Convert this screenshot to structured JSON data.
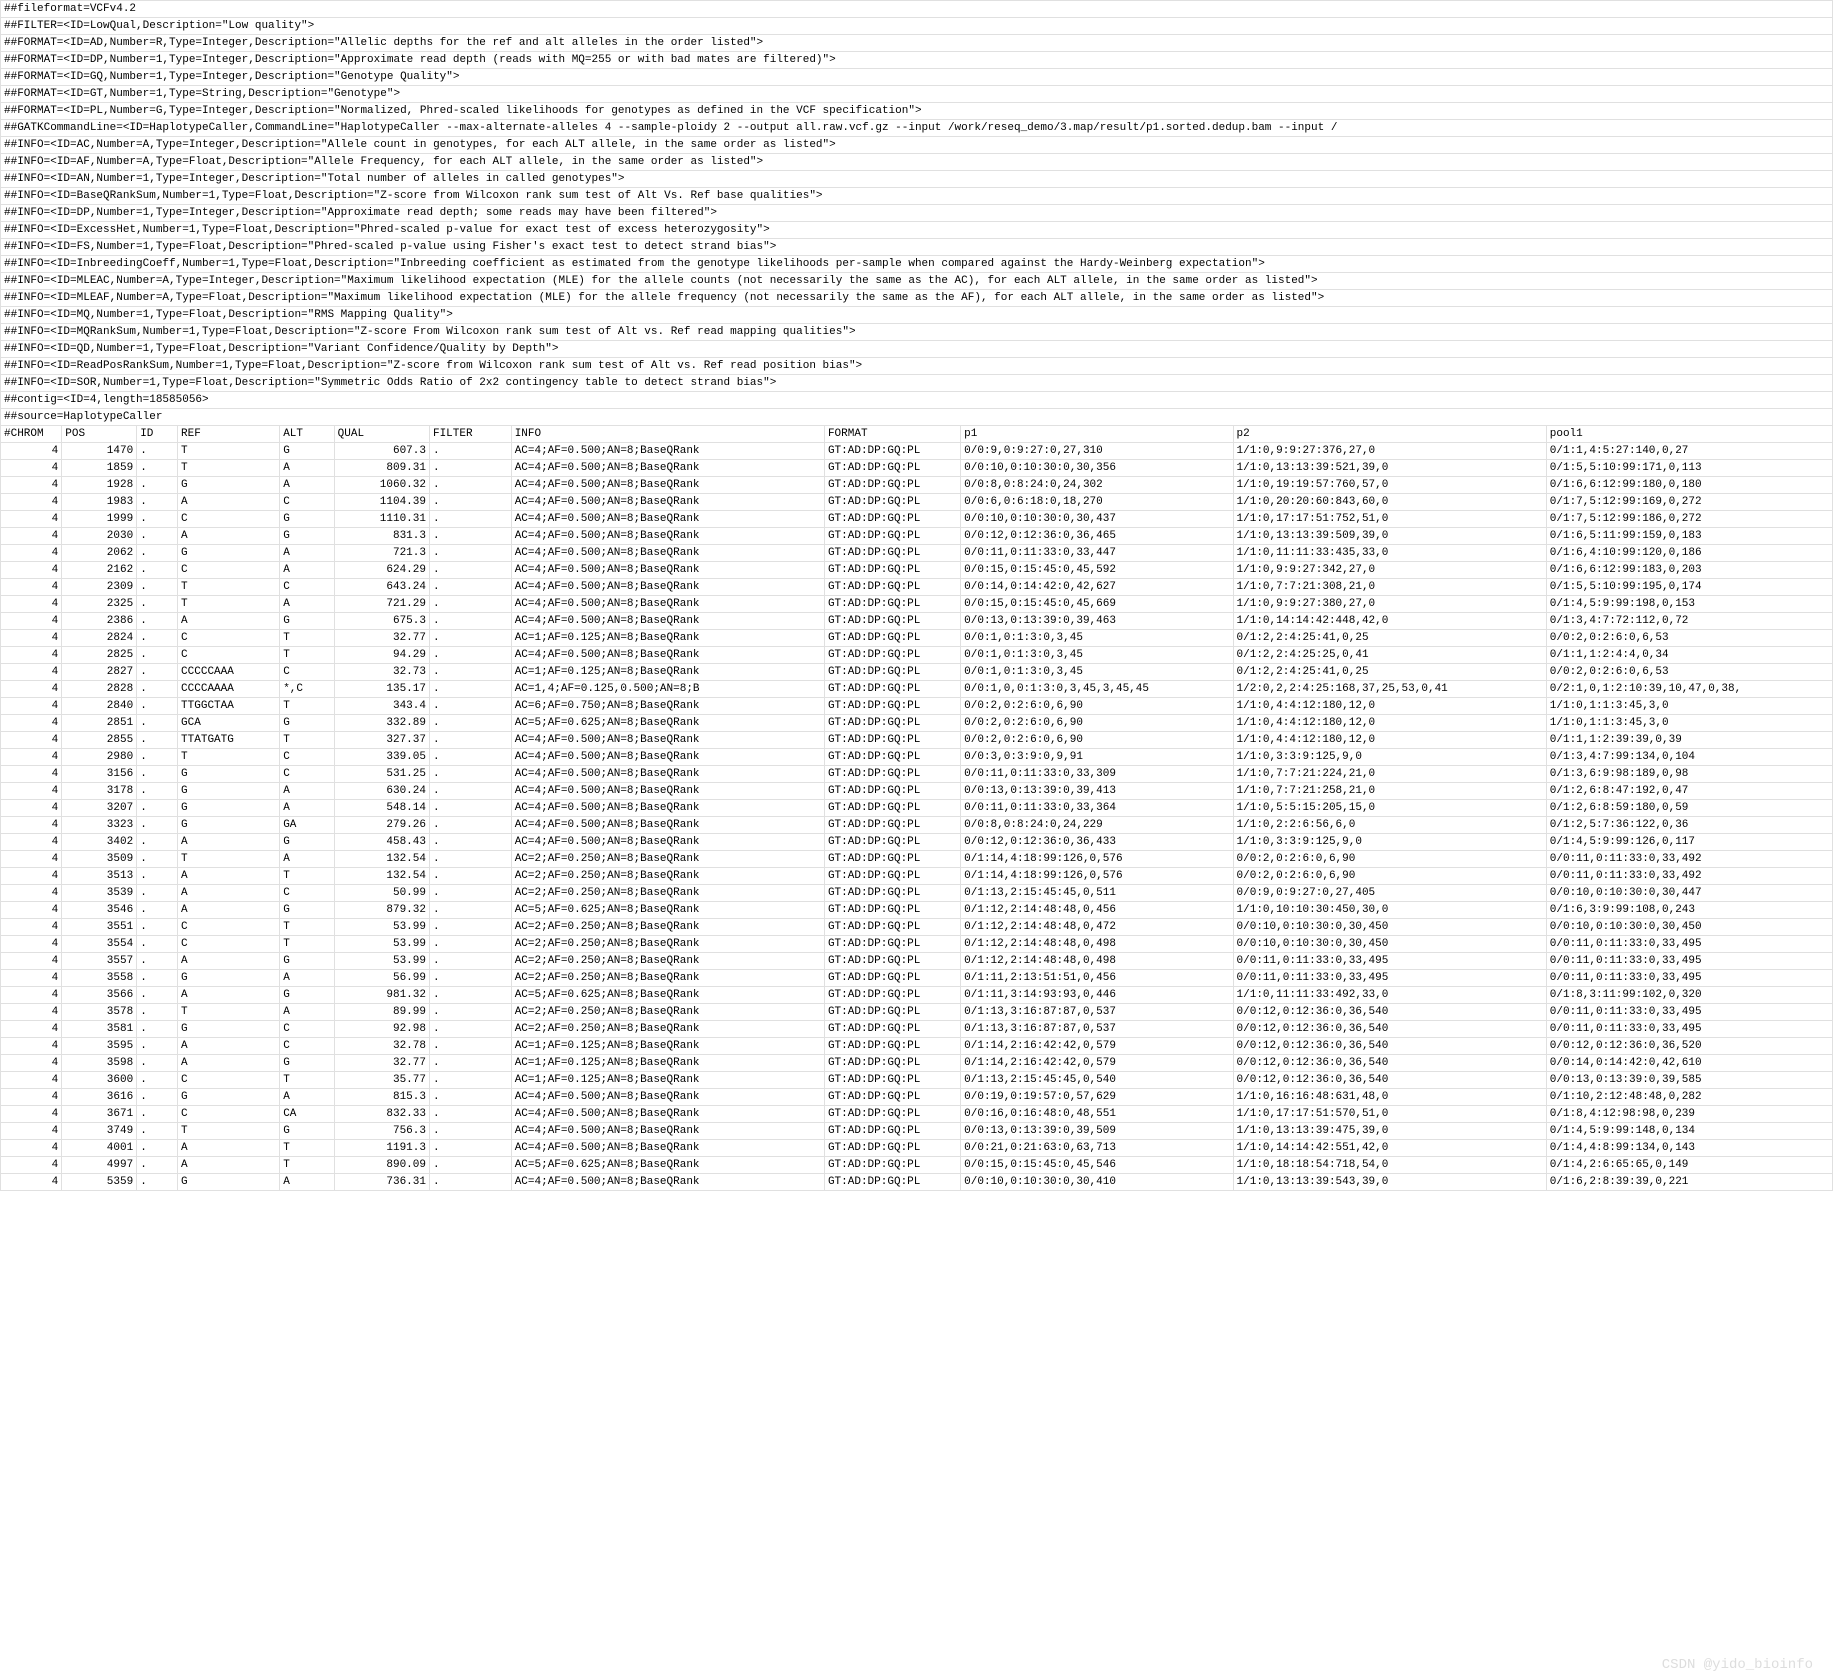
{
  "headers": [
    "##fileformat=VCFv4.2",
    "##FILTER=<ID=LowQual,Description=\"Low quality\">",
    "##FORMAT=<ID=AD,Number=R,Type=Integer,Description=\"Allelic depths for the ref and alt alleles in the order listed\">",
    "##FORMAT=<ID=DP,Number=1,Type=Integer,Description=\"Approximate read depth (reads with MQ=255 or with bad mates are filtered)\">",
    "##FORMAT=<ID=GQ,Number=1,Type=Integer,Description=\"Genotype Quality\">",
    "##FORMAT=<ID=GT,Number=1,Type=String,Description=\"Genotype\">",
    "##FORMAT=<ID=PL,Number=G,Type=Integer,Description=\"Normalized, Phred-scaled likelihoods for genotypes as defined in the VCF specification\">",
    "##GATKCommandLine=<ID=HaplotypeCaller,CommandLine=\"HaplotypeCaller  --max-alternate-alleles 4 --sample-ploidy 2 --output all.raw.vcf.gz --input /work/reseq_demo/3.map/result/p1.sorted.dedup.bam --input /",
    "##INFO=<ID=AC,Number=A,Type=Integer,Description=\"Allele count in genotypes, for each ALT allele, in the same order as listed\">",
    "##INFO=<ID=AF,Number=A,Type=Float,Description=\"Allele Frequency, for each ALT allele, in the same order as listed\">",
    "##INFO=<ID=AN,Number=1,Type=Integer,Description=\"Total number of alleles in called genotypes\">",
    "##INFO=<ID=BaseQRankSum,Number=1,Type=Float,Description=\"Z-score from Wilcoxon rank sum test of Alt Vs. Ref base qualities\">",
    "##INFO=<ID=DP,Number=1,Type=Integer,Description=\"Approximate read depth; some reads may have been filtered\">",
    "##INFO=<ID=ExcessHet,Number=1,Type=Float,Description=\"Phred-scaled p-value for exact test of excess heterozygosity\">",
    "##INFO=<ID=FS,Number=1,Type=Float,Description=\"Phred-scaled p-value using Fisher's exact test to detect strand bias\">",
    "##INFO=<ID=InbreedingCoeff,Number=1,Type=Float,Description=\"Inbreeding coefficient as estimated from the genotype likelihoods per-sample when compared against the Hardy-Weinberg expectation\">",
    "##INFO=<ID=MLEAC,Number=A,Type=Integer,Description=\"Maximum likelihood expectation (MLE) for the allele counts (not necessarily the same as the AC), for each ALT allele, in the same order as listed\">",
    "##INFO=<ID=MLEAF,Number=A,Type=Float,Description=\"Maximum likelihood expectation (MLE) for the allele frequency (not necessarily the same as the AF), for each ALT allele, in the same order as listed\">",
    "##INFO=<ID=MQ,Number=1,Type=Float,Description=\"RMS Mapping Quality\">",
    "##INFO=<ID=MQRankSum,Number=1,Type=Float,Description=\"Z-score From Wilcoxon rank sum test of Alt vs. Ref read mapping qualities\">",
    "##INFO=<ID=QD,Number=1,Type=Float,Description=\"Variant Confidence/Quality by Depth\">",
    "##INFO=<ID=ReadPosRankSum,Number=1,Type=Float,Description=\"Z-score from Wilcoxon rank sum test of Alt vs. Ref read position bias\">",
    "##INFO=<ID=SOR,Number=1,Type=Float,Description=\"Symmetric Odds Ratio of 2x2 contingency table to detect strand bias\">",
    "##contig=<ID=4,length=18585056>",
    "##source=HaplotypeCaller"
  ],
  "columns": [
    "#CHROM",
    "POS",
    "ID",
    "REF",
    "ALT",
    "QUAL",
    "FILTER",
    "INFO",
    "FORMAT",
    "p1",
    "p2",
    "pool1"
  ],
  "rows": [
    [
      "4",
      "1470",
      ".",
      "T",
      "G",
      "607.3",
      ".",
      "AC=4;AF=0.500;AN=8;BaseQRank",
      "GT:AD:DP:GQ:PL",
      "0/0:9,0:9:27:0,27,310",
      "1/1:0,9:9:27:376,27,0",
      "0/1:1,4:5:27:140,0,27"
    ],
    [
      "4",
      "1859",
      ".",
      "T",
      "A",
      "809.31",
      ".",
      "AC=4;AF=0.500;AN=8;BaseQRank",
      "GT:AD:DP:GQ:PL",
      "0/0:10,0:10:30:0,30,356",
      "1/1:0,13:13:39:521,39,0",
      "0/1:5,5:10:99:171,0,113"
    ],
    [
      "4",
      "1928",
      ".",
      "G",
      "A",
      "1060.32",
      ".",
      "AC=4;AF=0.500;AN=8;BaseQRank",
      "GT:AD:DP:GQ:PL",
      "0/0:8,0:8:24:0,24,302",
      "1/1:0,19:19:57:760,57,0",
      "0/1:6,6:12:99:180,0,180"
    ],
    [
      "4",
      "1983",
      ".",
      "A",
      "C",
      "1104.39",
      ".",
      "AC=4;AF=0.500;AN=8;BaseQRank",
      "GT:AD:DP:GQ:PL",
      "0/0:6,0:6:18:0,18,270",
      "1/1:0,20:20:60:843,60,0",
      "0/1:7,5:12:99:169,0,272"
    ],
    [
      "4",
      "1999",
      ".",
      "C",
      "G",
      "1110.31",
      ".",
      "AC=4;AF=0.500;AN=8;BaseQRank",
      "GT:AD:DP:GQ:PL",
      "0/0:10,0:10:30:0,30,437",
      "1/1:0,17:17:51:752,51,0",
      "0/1:7,5:12:99:186,0,272"
    ],
    [
      "4",
      "2030",
      ".",
      "A",
      "G",
      "831.3",
      ".",
      "AC=4;AF=0.500;AN=8;BaseQRank",
      "GT:AD:DP:GQ:PL",
      "0/0:12,0:12:36:0,36,465",
      "1/1:0,13:13:39:509,39,0",
      "0/1:6,5:11:99:159,0,183"
    ],
    [
      "4",
      "2062",
      ".",
      "G",
      "A",
      "721.3",
      ".",
      "AC=4;AF=0.500;AN=8;BaseQRank",
      "GT:AD:DP:GQ:PL",
      "0/0:11,0:11:33:0,33,447",
      "1/1:0,11:11:33:435,33,0",
      "0/1:6,4:10:99:120,0,186"
    ],
    [
      "4",
      "2162",
      ".",
      "C",
      "A",
      "624.29",
      ".",
      "AC=4;AF=0.500;AN=8;BaseQRank",
      "GT:AD:DP:GQ:PL",
      "0/0:15,0:15:45:0,45,592",
      "1/1:0,9:9:27:342,27,0",
      "0/1:6,6:12:99:183,0,203"
    ],
    [
      "4",
      "2309",
      ".",
      "T",
      "C",
      "643.24",
      ".",
      "AC=4;AF=0.500;AN=8;BaseQRank",
      "GT:AD:DP:GQ:PL",
      "0/0:14,0:14:42:0,42,627",
      "1/1:0,7:7:21:308,21,0",
      "0/1:5,5:10:99:195,0,174"
    ],
    [
      "4",
      "2325",
      ".",
      "T",
      "A",
      "721.29",
      ".",
      "AC=4;AF=0.500;AN=8;BaseQRank",
      "GT:AD:DP:GQ:PL",
      "0/0:15,0:15:45:0,45,669",
      "1/1:0,9:9:27:380,27,0",
      "0/1:4,5:9:99:198,0,153"
    ],
    [
      "4",
      "2386",
      ".",
      "A",
      "G",
      "675.3",
      ".",
      "AC=4;AF=0.500;AN=8;BaseQRank",
      "GT:AD:DP:GQ:PL",
      "0/0:13,0:13:39:0,39,463",
      "1/1:0,14:14:42:448,42,0",
      "0/1:3,4:7:72:112,0,72"
    ],
    [
      "4",
      "2824",
      ".",
      "C",
      "T",
      "32.77",
      ".",
      "AC=1;AF=0.125;AN=8;BaseQRank",
      "GT:AD:DP:GQ:PL",
      "0/0:1,0:1:3:0,3,45",
      "0/1:2,2:4:25:41,0,25",
      "0/0:2,0:2:6:0,6,53"
    ],
    [
      "4",
      "2825",
      ".",
      "C",
      "T",
      "94.29",
      ".",
      "AC=4;AF=0.500;AN=8;BaseQRank",
      "GT:AD:DP:GQ:PL",
      "0/0:1,0:1:3:0,3,45",
      "0/1:2,2:4:25:25,0,41",
      "0/1:1,1:2:4:4,0,34"
    ],
    [
      "4",
      "2827",
      ".",
      "CCCCCAAA",
      "C",
      "32.73",
      ".",
      "AC=1;AF=0.125;AN=8;BaseQRank",
      "GT:AD:DP:GQ:PL",
      "0/0:1,0:1:3:0,3,45",
      "0/1:2,2:4:25:41,0,25",
      "0/0:2,0:2:6:0,6,53"
    ],
    [
      "4",
      "2828",
      ".",
      "CCCCAAAA",
      "*,C",
      "135.17",
      ".",
      "AC=1,4;AF=0.125,0.500;AN=8;B",
      "GT:AD:DP:GQ:PL",
      "0/0:1,0,0:1:3:0,3,45,3,45,45",
      "1/2:0,2,2:4:25:168,37,25,53,0,41",
      "0/2:1,0,1:2:10:39,10,47,0,38,"
    ],
    [
      "4",
      "2840",
      ".",
      "TTGGCTAA",
      "T",
      "343.4",
      ".",
      "AC=6;AF=0.750;AN=8;BaseQRank",
      "GT:AD:DP:GQ:PL",
      "0/0:2,0:2:6:0,6,90",
      "1/1:0,4:4:12:180,12,0",
      "1/1:0,1:1:3:45,3,0"
    ],
    [
      "4",
      "2851",
      ".",
      "GCA",
      "G",
      "332.89",
      ".",
      "AC=5;AF=0.625;AN=8;BaseQRank",
      "GT:AD:DP:GQ:PL",
      "0/0:2,0:2:6:0,6,90",
      "1/1:0,4:4:12:180,12,0",
      "1/1:0,1:1:3:45,3,0"
    ],
    [
      "4",
      "2855",
      ".",
      "TTATGATG",
      "T",
      "327.37",
      ".",
      "AC=4;AF=0.500;AN=8;BaseQRank",
      "GT:AD:DP:GQ:PL",
      "0/0:2,0:2:6:0,6,90",
      "1/1:0,4:4:12:180,12,0",
      "0/1:1,1:2:39:39,0,39"
    ],
    [
      "4",
      "2980",
      ".",
      "T",
      "C",
      "339.05",
      ".",
      "AC=4;AF=0.500;AN=8;BaseQRank",
      "GT:AD:DP:GQ:PL",
      "0/0:3,0:3:9:0,9,91",
      "1/1:0,3:3:9:125,9,0",
      "0/1:3,4:7:99:134,0,104"
    ],
    [
      "4",
      "3156",
      ".",
      "G",
      "C",
      "531.25",
      ".",
      "AC=4;AF=0.500;AN=8;BaseQRank",
      "GT:AD:DP:GQ:PL",
      "0/0:11,0:11:33:0,33,309",
      "1/1:0,7:7:21:224,21,0",
      "0/1:3,6:9:98:189,0,98"
    ],
    [
      "4",
      "3178",
      ".",
      "G",
      "A",
      "630.24",
      ".",
      "AC=4;AF=0.500;AN=8;BaseQRank",
      "GT:AD:DP:GQ:PL",
      "0/0:13,0:13:39:0,39,413",
      "1/1:0,7:7:21:258,21,0",
      "0/1:2,6:8:47:192,0,47"
    ],
    [
      "4",
      "3207",
      ".",
      "G",
      "A",
      "548.14",
      ".",
      "AC=4;AF=0.500;AN=8;BaseQRank",
      "GT:AD:DP:GQ:PL",
      "0/0:11,0:11:33:0,33,364",
      "1/1:0,5:5:15:205,15,0",
      "0/1:2,6:8:59:180,0,59"
    ],
    [
      "4",
      "3323",
      ".",
      "G",
      "GA",
      "279.26",
      ".",
      "AC=4;AF=0.500;AN=8;BaseQRank",
      "GT:AD:DP:GQ:PL",
      "0/0:8,0:8:24:0,24,229",
      "1/1:0,2:2:6:56,6,0",
      "0/1:2,5:7:36:122,0,36"
    ],
    [
      "4",
      "3402",
      ".",
      "A",
      "G",
      "458.43",
      ".",
      "AC=4;AF=0.500;AN=8;BaseQRank",
      "GT:AD:DP:GQ:PL",
      "0/0:12,0:12:36:0,36,433",
      "1/1:0,3:3:9:125,9,0",
      "0/1:4,5:9:99:126,0,117"
    ],
    [
      "4",
      "3509",
      ".",
      "T",
      "A",
      "132.54",
      ".",
      "AC=2;AF=0.250;AN=8;BaseQRank",
      "GT:AD:DP:GQ:PL",
      "0/1:14,4:18:99:126,0,576",
      "0/0:2,0:2:6:0,6,90",
      "0/0:11,0:11:33:0,33,492"
    ],
    [
      "4",
      "3513",
      ".",
      "A",
      "T",
      "132.54",
      ".",
      "AC=2;AF=0.250;AN=8;BaseQRank",
      "GT:AD:DP:GQ:PL",
      "0/1:14,4:18:99:126,0,576",
      "0/0:2,0:2:6:0,6,90",
      "0/0:11,0:11:33:0,33,492"
    ],
    [
      "4",
      "3539",
      ".",
      "A",
      "C",
      "50.99",
      ".",
      "AC=2;AF=0.250;AN=8;BaseQRank",
      "GT:AD:DP:GQ:PL",
      "0/1:13,2:15:45:45,0,511",
      "0/0:9,0:9:27:0,27,405",
      "0/0:10,0:10:30:0,30,447"
    ],
    [
      "4",
      "3546",
      ".",
      "A",
      "G",
      "879.32",
      ".",
      "AC=5;AF=0.625;AN=8;BaseQRank",
      "GT:AD:DP:GQ:PL",
      "0/1:12,2:14:48:48,0,456",
      "1/1:0,10:10:30:450,30,0",
      "0/1:6,3:9:99:108,0,243"
    ],
    [
      "4",
      "3551",
      ".",
      "C",
      "T",
      "53.99",
      ".",
      "AC=2;AF=0.250;AN=8;BaseQRank",
      "GT:AD:DP:GQ:PL",
      "0/1:12,2:14:48:48,0,472",
      "0/0:10,0:10:30:0,30,450",
      "0/0:10,0:10:30:0,30,450"
    ],
    [
      "4",
      "3554",
      ".",
      "C",
      "T",
      "53.99",
      ".",
      "AC=2;AF=0.250;AN=8;BaseQRank",
      "GT:AD:DP:GQ:PL",
      "0/1:12,2:14:48:48,0,498",
      "0/0:10,0:10:30:0,30,450",
      "0/0:11,0:11:33:0,33,495"
    ],
    [
      "4",
      "3557",
      ".",
      "A",
      "G",
      "53.99",
      ".",
      "AC=2;AF=0.250;AN=8;BaseQRank",
      "GT:AD:DP:GQ:PL",
      "0/1:12,2:14:48:48,0,498",
      "0/0:11,0:11:33:0,33,495",
      "0/0:11,0:11:33:0,33,495"
    ],
    [
      "4",
      "3558",
      ".",
      "G",
      "A",
      "56.99",
      ".",
      "AC=2;AF=0.250;AN=8;BaseQRank",
      "GT:AD:DP:GQ:PL",
      "0/1:11,2:13:51:51,0,456",
      "0/0:11,0:11:33:0,33,495",
      "0/0:11,0:11:33:0,33,495"
    ],
    [
      "4",
      "3566",
      ".",
      "A",
      "G",
      "981.32",
      ".",
      "AC=5;AF=0.625;AN=8;BaseQRank",
      "GT:AD:DP:GQ:PL",
      "0/1:11,3:14:93:93,0,446",
      "1/1:0,11:11:33:492,33,0",
      "0/1:8,3:11:99:102,0,320"
    ],
    [
      "4",
      "3578",
      ".",
      "T",
      "A",
      "89.99",
      ".",
      "AC=2;AF=0.250;AN=8;BaseQRank",
      "GT:AD:DP:GQ:PL",
      "0/1:13,3:16:87:87,0,537",
      "0/0:12,0:12:36:0,36,540",
      "0/0:11,0:11:33:0,33,495"
    ],
    [
      "4",
      "3581",
      ".",
      "G",
      "C",
      "92.98",
      ".",
      "AC=2;AF=0.250;AN=8;BaseQRank",
      "GT:AD:DP:GQ:PL",
      "0/1:13,3:16:87:87,0,537",
      "0/0:12,0:12:36:0,36,540",
      "0/0:11,0:11:33:0,33,495"
    ],
    [
      "4",
      "3595",
      ".",
      "A",
      "C",
      "32.78",
      ".",
      "AC=1;AF=0.125;AN=8;BaseQRank",
      "GT:AD:DP:GQ:PL",
      "0/1:14,2:16:42:42,0,579",
      "0/0:12,0:12:36:0,36,540",
      "0/0:12,0:12:36:0,36,520"
    ],
    [
      "4",
      "3598",
      ".",
      "A",
      "G",
      "32.77",
      ".",
      "AC=1;AF=0.125;AN=8;BaseQRank",
      "GT:AD:DP:GQ:PL",
      "0/1:14,2:16:42:42,0,579",
      "0/0:12,0:12:36:0,36,540",
      "0/0:14,0:14:42:0,42,610"
    ],
    [
      "4",
      "3600",
      ".",
      "C",
      "T",
      "35.77",
      ".",
      "AC=1;AF=0.125;AN=8;BaseQRank",
      "GT:AD:DP:GQ:PL",
      "0/1:13,2:15:45:45,0,540",
      "0/0:12,0:12:36:0,36,540",
      "0/0:13,0:13:39:0,39,585"
    ],
    [
      "4",
      "3616",
      ".",
      "G",
      "A",
      "815.3",
      ".",
      "AC=4;AF=0.500;AN=8;BaseQRank",
      "GT:AD:DP:GQ:PL",
      "0/0:19,0:19:57:0,57,629",
      "1/1:0,16:16:48:631,48,0",
      "0/1:10,2:12:48:48,0,282"
    ],
    [
      "4",
      "3671",
      ".",
      "C",
      "CA",
      "832.33",
      ".",
      "AC=4;AF=0.500;AN=8;BaseQRank",
      "GT:AD:DP:GQ:PL",
      "0/0:16,0:16:48:0,48,551",
      "1/1:0,17:17:51:570,51,0",
      "0/1:8,4:12:98:98,0,239"
    ],
    [
      "4",
      "3749",
      ".",
      "T",
      "G",
      "756.3",
      ".",
      "AC=4;AF=0.500;AN=8;BaseQRank",
      "GT:AD:DP:GQ:PL",
      "0/0:13,0:13:39:0,39,509",
      "1/1:0,13:13:39:475,39,0",
      "0/1:4,5:9:99:148,0,134"
    ],
    [
      "4",
      "4001",
      ".",
      "A",
      "T",
      "1191.3",
      ".",
      "AC=4;AF=0.500;AN=8;BaseQRank",
      "GT:AD:DP:GQ:PL",
      "0/0:21,0:21:63:0,63,713",
      "1/1:0,14:14:42:551,42,0",
      "0/1:4,4:8:99:134,0,143"
    ],
    [
      "4",
      "4997",
      ".",
      "A",
      "T",
      "890.09",
      ".",
      "AC=5;AF=0.625;AN=8;BaseQRank",
      "GT:AD:DP:GQ:PL",
      "0/0:15,0:15:45:0,45,546",
      "1/1:0,18:18:54:718,54,0",
      "0/1:4,2:6:65:65,0,149"
    ],
    [
      "4",
      "5359",
      ".",
      "G",
      "A",
      "736.31",
      ".",
      "AC=4;AF=0.500;AN=8;BaseQRank",
      "GT:AD:DP:GQ:PL",
      "0/0:10,0:10:30:0,30,410",
      "1/1:0,13:13:39:543,39,0",
      "0/1:6,2:8:39:39,0,221"
    ]
  ]
}
